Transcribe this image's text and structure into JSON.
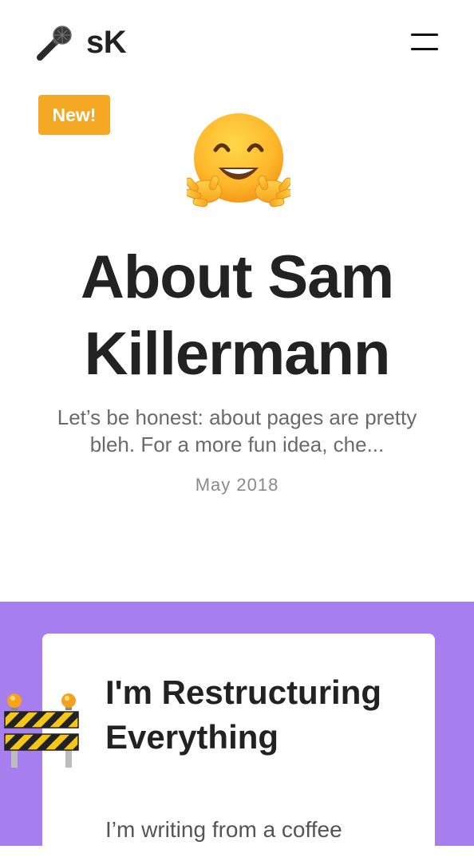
{
  "header": {
    "logo_text": "sK",
    "logo_icon": "microphone-icon",
    "menu_icon": "hamburger-menu-icon"
  },
  "hero": {
    "badge": "New!",
    "emoji": "hugging-face-icon",
    "title": "About Sam Killermann",
    "excerpt": "Let’s be honest: about pages are pretty bleh. For a more fun idea, che...",
    "date": "May 2018"
  },
  "featured": {
    "icon": "construction-barrier-icon",
    "title": "I'm Restructuring Everything",
    "text": "I’m writing from a coffee"
  },
  "colors": {
    "badge": "#f4a823",
    "section_bg": "#a77eee",
    "card_bg": "#ffffff",
    "text": "#222222",
    "muted": "#6a6a6a"
  }
}
